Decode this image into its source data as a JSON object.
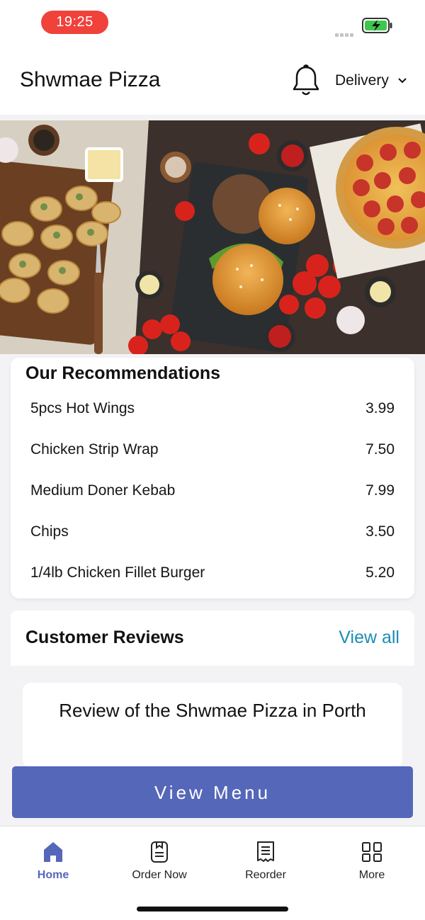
{
  "status_bar": {
    "time": "19:25",
    "battery": "charging",
    "time_pill_color": "#f0413b"
  },
  "header": {
    "title": "Shwmae Pizza",
    "bell_icon": "bell-icon",
    "delivery_label": "Delivery",
    "dropdown_icon": "chevron-down-icon"
  },
  "recommendations": {
    "title": "Our Recommendations",
    "items": [
      {
        "name": "5pcs Hot Wings",
        "price": "3.99"
      },
      {
        "name": "Chicken Strip Wrap",
        "price": "7.50"
      },
      {
        "name": "Medium Doner Kebab",
        "price": "7.99"
      },
      {
        "name": "Chips",
        "price": "3.50"
      },
      {
        "name": "1/4lb Chicken Fillet Burger",
        "price": "5.20"
      }
    ]
  },
  "reviews": {
    "title": "Customer Reviews",
    "view_all": "View all",
    "card_title": "Review of the Shwmae Pizza in Porth"
  },
  "cta": {
    "label": "View Menu",
    "color": "#5567b9"
  },
  "bottom_nav": {
    "items": [
      {
        "label": "Home",
        "icon": "home-icon",
        "active": true
      },
      {
        "label": "Order Now",
        "icon": "order-icon",
        "active": false
      },
      {
        "label": "Reorder",
        "icon": "receipt-icon",
        "active": false
      },
      {
        "label": "More",
        "icon": "grid-icon",
        "active": false
      }
    ]
  },
  "colors": {
    "accent": "#5567b9",
    "link": "#1b8db3"
  }
}
